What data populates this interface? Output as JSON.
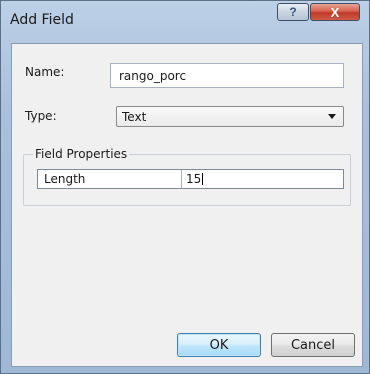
{
  "window": {
    "title": "Add Field",
    "help_label": "?",
    "close_label": "X"
  },
  "form": {
    "name_label": "Name:",
    "name_value": "rango_porc",
    "type_label": "Type:",
    "type_value": "Text"
  },
  "field_properties": {
    "legend": "Field Properties",
    "rows": [
      {
        "key": "Length",
        "value": "15"
      }
    ]
  },
  "buttons": {
    "ok_label": "OK",
    "cancel_label": "Cancel"
  },
  "colors": {
    "titlebar": "#a9c0dc",
    "close_button": "#c1392a",
    "ok_button_border": "#3c7fb1"
  }
}
